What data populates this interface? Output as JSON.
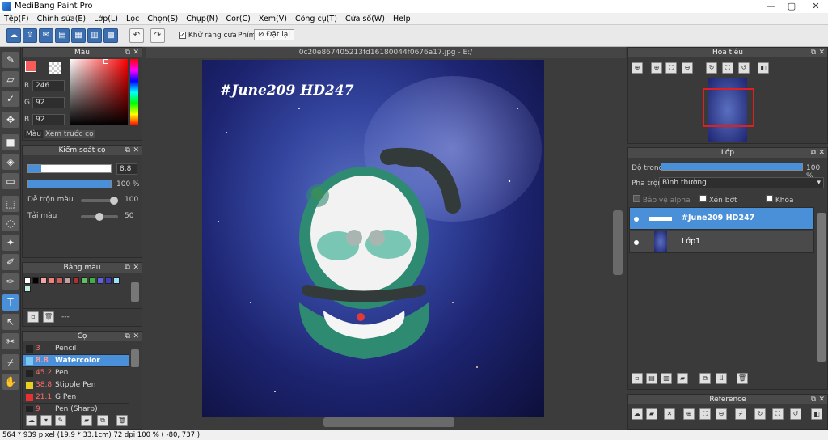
{
  "app": {
    "title": "MediBang Paint Pro"
  },
  "menu": [
    "Tệp(F)",
    "Chỉnh sửa(E)",
    "Lớp(L)",
    "Lọc",
    "Chọn(S)",
    "Chụp(N)",
    "Cor(C)",
    "Xem(V)",
    "Công cụ(T)",
    "Cửa sổ(W)",
    "Help"
  ],
  "toolbar": {
    "antialias_label": "Khử răng cưa",
    "hotkey_label": "Phím",
    "reset_label": "Đặt lại"
  },
  "color_panel": {
    "title": "Màu",
    "r_label": "R",
    "r_value": "246",
    "g_label": "G",
    "g_value": "92",
    "b_label": "B",
    "b_value": "92",
    "tab_color": "Màu",
    "tab_preview": "Xem trước cọ",
    "fg_color": "#f65c5c"
  },
  "brush_control": {
    "title": "Kiểm soát cọ",
    "size": "8.8",
    "opacity": "100 %",
    "blend_label": "Dễ trộn màu",
    "blend_value": "100",
    "load_label": "Tải màu",
    "load_value": "50"
  },
  "palette": {
    "title": "Bảng màu",
    "dash": "---",
    "colors": [
      "#ffffff",
      "#000000",
      "#f4a4a4",
      "#f08080",
      "#d06060",
      "#c0a0a0",
      "#b03030",
      "#60c060",
      "#40b040",
      "#6060e0",
      "#4040c0",
      "#a0e0ff",
      "#c0f0e0"
    ]
  },
  "brushes": {
    "title": "Cọ",
    "items": [
      {
        "size": "3",
        "name": "Pencil",
        "color": "#222222"
      },
      {
        "size": "8.8",
        "name": "Watercolor",
        "color": "#78c8f0"
      },
      {
        "size": "45.2",
        "name": "Pen",
        "color": "#222222"
      },
      {
        "size": "38.8",
        "name": "Stipple Pen",
        "color": "#e8d020"
      },
      {
        "size": "21.1",
        "name": "G Pen",
        "color": "#e83030"
      },
      {
        "size": "9",
        "name": "Pen (Sharp)",
        "color": "#222222"
      }
    ]
  },
  "document": {
    "tab": "0c20e867405213fd16180044f0676a17.jpg - E:/",
    "artwork_text": "#June209 HD247"
  },
  "navigator": {
    "title": "Hoa tiêu"
  },
  "layers": {
    "title": "Lớp",
    "opacity_label": "Độ trong",
    "opacity_value": "100 %",
    "blend_label": "Pha trộn",
    "blend_value": "Bình thường",
    "protect_alpha": "Bảo vệ alpha",
    "clip": "Xén bớt",
    "lock": "Khóa",
    "items": [
      {
        "name": "#June209 HD247"
      },
      {
        "name": "Lớp1"
      }
    ]
  },
  "reference": {
    "title": "Reference"
  },
  "status": "564 * 939 pixel   (19.9 * 33.1cm)   72 dpi   100 %   ( -80, 737 )"
}
